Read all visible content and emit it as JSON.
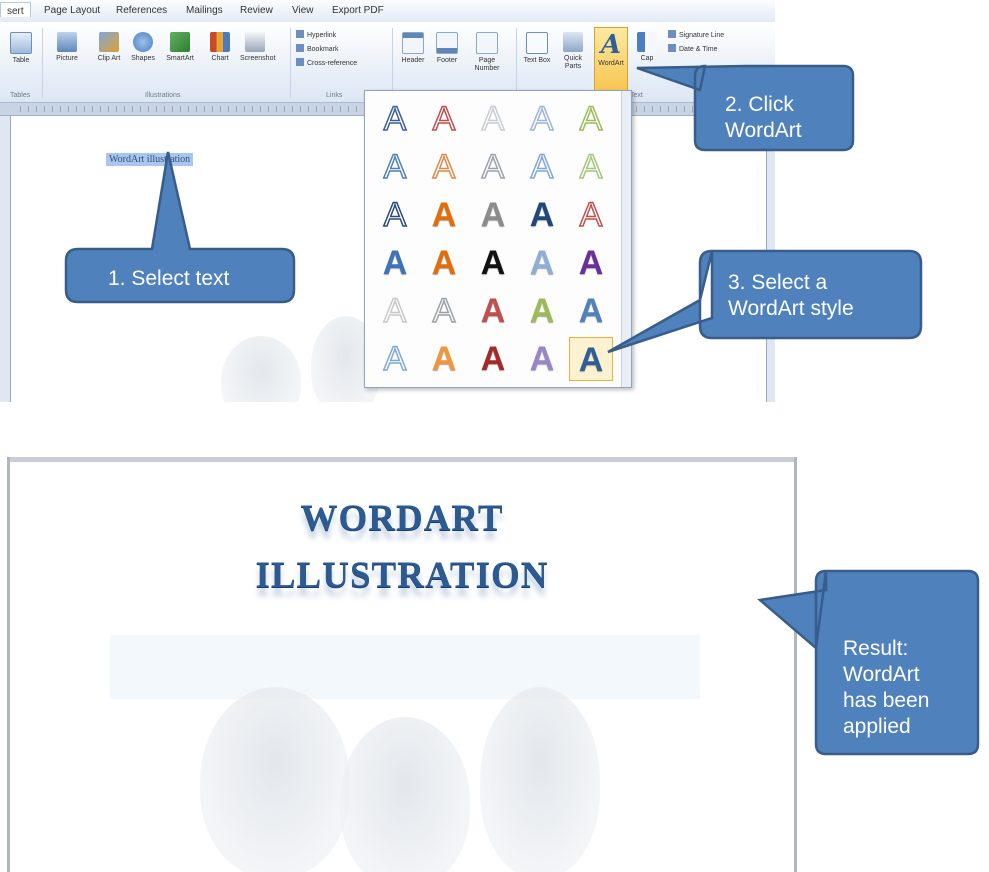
{
  "ribbon": {
    "tabs": [
      "sert",
      "Page Layout",
      "References",
      "Mailings",
      "Review",
      "View",
      "Export PDF"
    ],
    "buttons": [
      {
        "label": "Table",
        "icon": "table-icon"
      },
      {
        "label": "Picture",
        "icon": "picture-icon"
      },
      {
        "label": "Clip Art",
        "icon": "clip-art-icon"
      },
      {
        "label": "Shapes",
        "icon": "shapes-icon"
      },
      {
        "label": "SmartArt",
        "icon": "smartart-icon"
      },
      {
        "label": "Chart",
        "icon": "chart-icon"
      },
      {
        "label": "Screenshot",
        "icon": "screenshot-icon"
      },
      {
        "label": "Header",
        "icon": "header-icon"
      },
      {
        "label": "Footer",
        "icon": "footer-icon"
      },
      {
        "label": "Page Number",
        "icon": "page-number-icon"
      },
      {
        "label": "Text Box",
        "icon": "text-box-icon"
      },
      {
        "label": "Quick Parts",
        "icon": "quick-parts-icon"
      }
    ],
    "wordart_label": "WordArt",
    "dropcap_label": "Cap",
    "links": [
      "Hyperlink",
      "Bookmark",
      "Cross-reference"
    ],
    "text_items": [
      "Signature Line",
      "Date & Time"
    ],
    "groups": [
      "Tables",
      "Illustrations",
      "Links",
      "Text"
    ]
  },
  "document": {
    "selected_text": "WordArt illustration"
  },
  "result": {
    "line1": "WORDART",
    "line2": "ILLUSTRATION"
  },
  "callouts": {
    "step1": "1. Select text",
    "step2": [
      "2. Click",
      "WordArt"
    ],
    "step3": [
      "3. Select a",
      "WordArt style"
    ],
    "result": [
      "Result:",
      "WordArt",
      "has been",
      "applied"
    ],
    "fill_color": "#4f81bd",
    "border_color": "#385d8a"
  },
  "gallery": {
    "selected_style": "row 6, column 5"
  }
}
